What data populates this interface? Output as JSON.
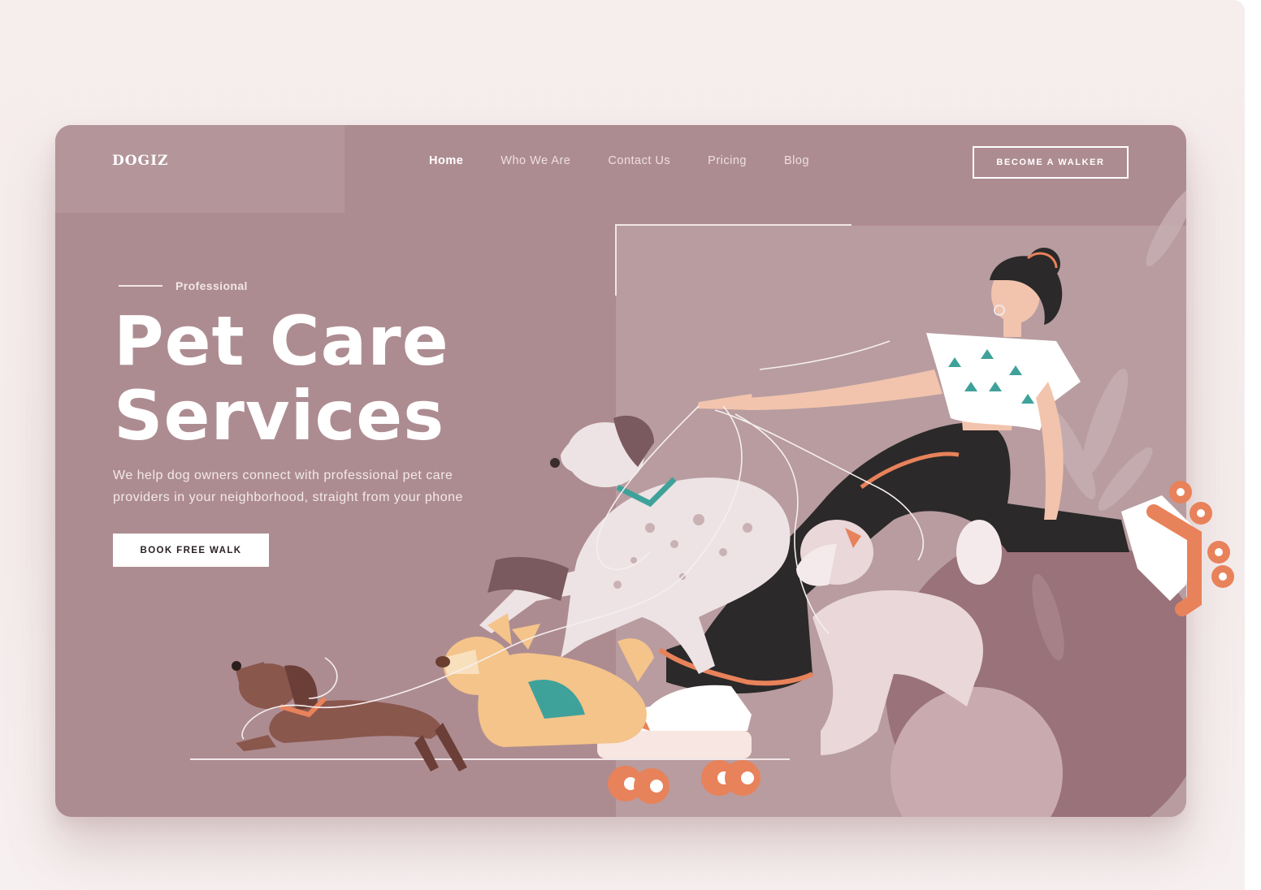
{
  "brand": {
    "name": "DOGIZ"
  },
  "nav": {
    "items": [
      {
        "label": "Home",
        "active": true
      },
      {
        "label": "Who We Are",
        "active": false
      },
      {
        "label": "Contact Us",
        "active": false
      },
      {
        "label": "Pricing",
        "active": false
      },
      {
        "label": "Blog",
        "active": false
      }
    ],
    "cta_label": "BECOME A WALKER"
  },
  "hero": {
    "eyebrow": "Professional",
    "title_line1": "Pet Care",
    "title_line2": "Services",
    "description_line1": "We help dog owners connect with professional pet care",
    "description_line2": "providers in your neighborhood, straight from your phone",
    "button_label": "BOOK FREE WALK"
  },
  "colors": {
    "card_background": "#ad8c91",
    "page_background": "#f6eded",
    "text_primary": "#ffffff",
    "accent_orange": "#e8825a",
    "accent_teal": "#3fa29a"
  }
}
